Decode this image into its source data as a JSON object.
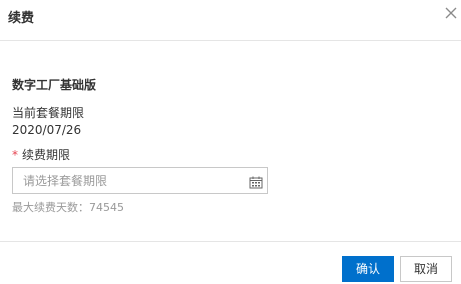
{
  "dialog": {
    "title": "续费",
    "close_icon": "close-icon"
  },
  "product": {
    "name": "数字工厂基础版"
  },
  "current_plan": {
    "label": "当前套餐期限",
    "value": "2020/07/26"
  },
  "renew_period": {
    "required_mark": "*",
    "label": "续费期限",
    "placeholder": "请选择套餐期限",
    "value": "",
    "icon": "calendar-icon"
  },
  "hint": {
    "text": "最大续费天数：74545"
  },
  "footer": {
    "confirm_label": "确认",
    "cancel_label": "取消"
  },
  "colors": {
    "primary": "#0070cc",
    "required": "#e64552",
    "border": "#c8c8c8",
    "hint": "#999999"
  }
}
